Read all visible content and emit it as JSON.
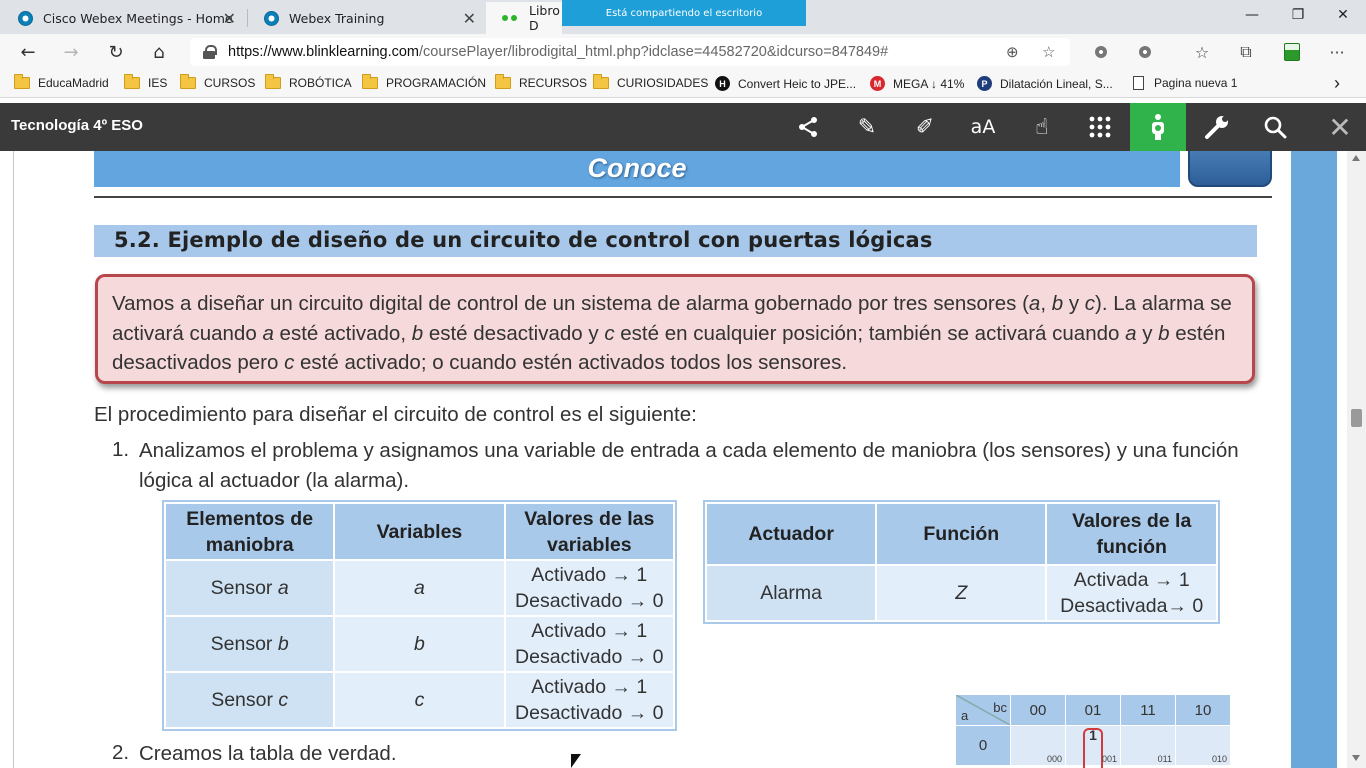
{
  "browser": {
    "tabs": [
      {
        "title": "Cisco Webex Meetings - Home",
        "close": "✕"
      },
      {
        "title": "Webex Training",
        "close": "✕"
      },
      {
        "title": "Libro D",
        "close": ""
      }
    ],
    "sharing_banner": "Está compartiendo el escritorio",
    "window_controls": {
      "minimize": "—",
      "restore": "❐",
      "close": "✕"
    },
    "nav": {
      "back": "←",
      "forward": "→",
      "reload": "↻",
      "home": "⌂"
    },
    "url_host": "https://www.blinklearning.com",
    "url_rest": "/coursePlayer/librodigital_html.php?idclase=44582720&idcurso=847849#",
    "omni_icons": {
      "zoom": "⊕",
      "favorite": "☆"
    },
    "toolbar_icons": {
      "favorites": "☆",
      "collections": "⧉",
      "more": "···"
    },
    "bookmarks": [
      {
        "label": "EducaMadrid",
        "icon": "folder"
      },
      {
        "label": "IES",
        "icon": "folder"
      },
      {
        "label": "CURSOS",
        "icon": "folder"
      },
      {
        "label": "ROBÓTICA",
        "icon": "folder"
      },
      {
        "label": "PROGRAMACIÓN",
        "icon": "folder"
      },
      {
        "label": "RECURSOS",
        "icon": "folder"
      },
      {
        "label": "CURIOSIDADES",
        "icon": "folder"
      },
      {
        "label": "Convert Heic to JPE...",
        "icon": "H"
      },
      {
        "label": "MEGA ↓ 41%",
        "icon": "M"
      },
      {
        "label": "Dilatación Lineal, S...",
        "icon": "P"
      },
      {
        "label": "Pagina nueva 1",
        "icon": "page"
      }
    ],
    "bookmarks_more": "›"
  },
  "app": {
    "title": "Tecnología 4º ESO",
    "icons": {
      "share": "⟨",
      "pencil": "✎",
      "marker": "✐",
      "text_size": "aA",
      "touch": "☝",
      "apps": "⠿",
      "accessibility": "♿",
      "tools": "🔧",
      "search": "⌕",
      "close": "✕"
    }
  },
  "page": {
    "banner": "Conoce",
    "section_title": "5.2. Ejemplo de diseño de un circuito de control con puertas lógicas",
    "callout": {
      "p1": "Vamos a diseñar un circuito digital de control de un sistema de alarma gobernado por tres sensores (",
      "a": "a",
      "sep1": ", ",
      "b": "b",
      "y": " y ",
      "c": "c",
      "p2": "). La alarma se activará cuando ",
      "a2": "a",
      "p3": " esté activado, ",
      "b2": "b",
      "p4": " esté desactivado y ",
      "c2": "c",
      "p5": " esté en cualquier posición; también se activará cuando ",
      "a3": "a",
      "y2": " y ",
      "b3": "b",
      "p6": " estén desactivados pero ",
      "c3": "c",
      "p7": " esté activado; o cuando estén activados todos los sensores."
    },
    "intro": "El procedimiento para diseñar el circuito de control es el siguiente:",
    "step1_num": "1.",
    "step1_text": "Analizamos el problema y asignamos una variable de entrada a cada elemento de maniobra (los sensores) y una función lógica al actuador (la alarma).",
    "step2_num": "2.",
    "step2_text": "Creamos la tabla de verdad."
  },
  "table_inputs": {
    "headers": [
      "Elementos de maniobra",
      "Variables",
      "Valores de las variables"
    ],
    "rows": [
      {
        "element_prefix": "Sensor ",
        "element_var": "a",
        "variable": "a",
        "v1": "Activado → 1",
        "v2": "Desactivado → 0"
      },
      {
        "element_prefix": "Sensor ",
        "element_var": "b",
        "variable": "b",
        "v1": "Activado → 1",
        "v2": "Desactivado → 0"
      },
      {
        "element_prefix": "Sensor ",
        "element_var": "c",
        "variable": "c",
        "v1": "Activado → 1",
        "v2": "Desactivado → 0"
      }
    ]
  },
  "table_output": {
    "headers": [
      "Actuador",
      "Función",
      "Valores de la función"
    ],
    "row": {
      "actuator": "Alarma",
      "function": "Z",
      "v1": "Activada → 1",
      "v2": "Desactivada→ 0"
    }
  },
  "kmap": {
    "corner_a": "a",
    "corner_bc": "bc",
    "cols": [
      "00",
      "01",
      "11",
      "10"
    ],
    "row0_label": "0",
    "row0": [
      {
        "value": "",
        "index": "000"
      },
      {
        "value": "1",
        "index": "001"
      },
      {
        "value": "",
        "index": "011"
      },
      {
        "value": "",
        "index": "010"
      }
    ]
  }
}
